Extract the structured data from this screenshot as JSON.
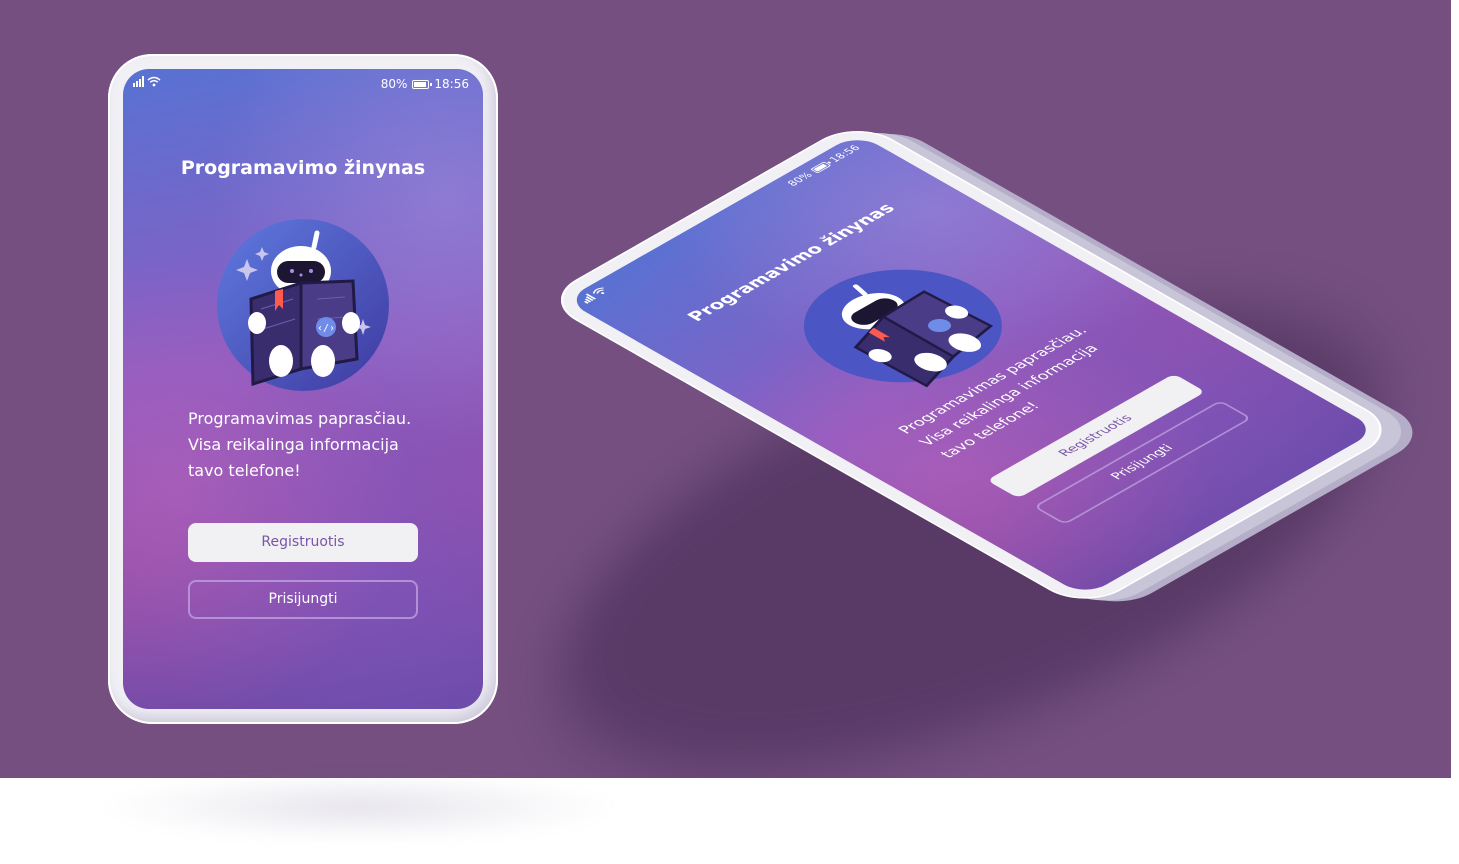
{
  "status_bar": {
    "battery": "80%",
    "time": "18:56"
  },
  "app": {
    "title": "Programavimo žinynas",
    "tagline": [
      "Programavimas paprasčiau.",
      "Visa reikalinga informacija",
      "tavo telefone!"
    ],
    "register_label": "Registruotis",
    "login_label": "Prisijungti"
  },
  "icons": {
    "signal": "signal-icon",
    "wifi": "wifi-icon",
    "battery": "battery-icon",
    "mascot": "robot-reading-book-icon"
  },
  "colors": {
    "background": "#744f80",
    "screen_top": "#5872d3",
    "screen_bottom": "#6a4aa8",
    "register_text": "#7a55a8"
  }
}
